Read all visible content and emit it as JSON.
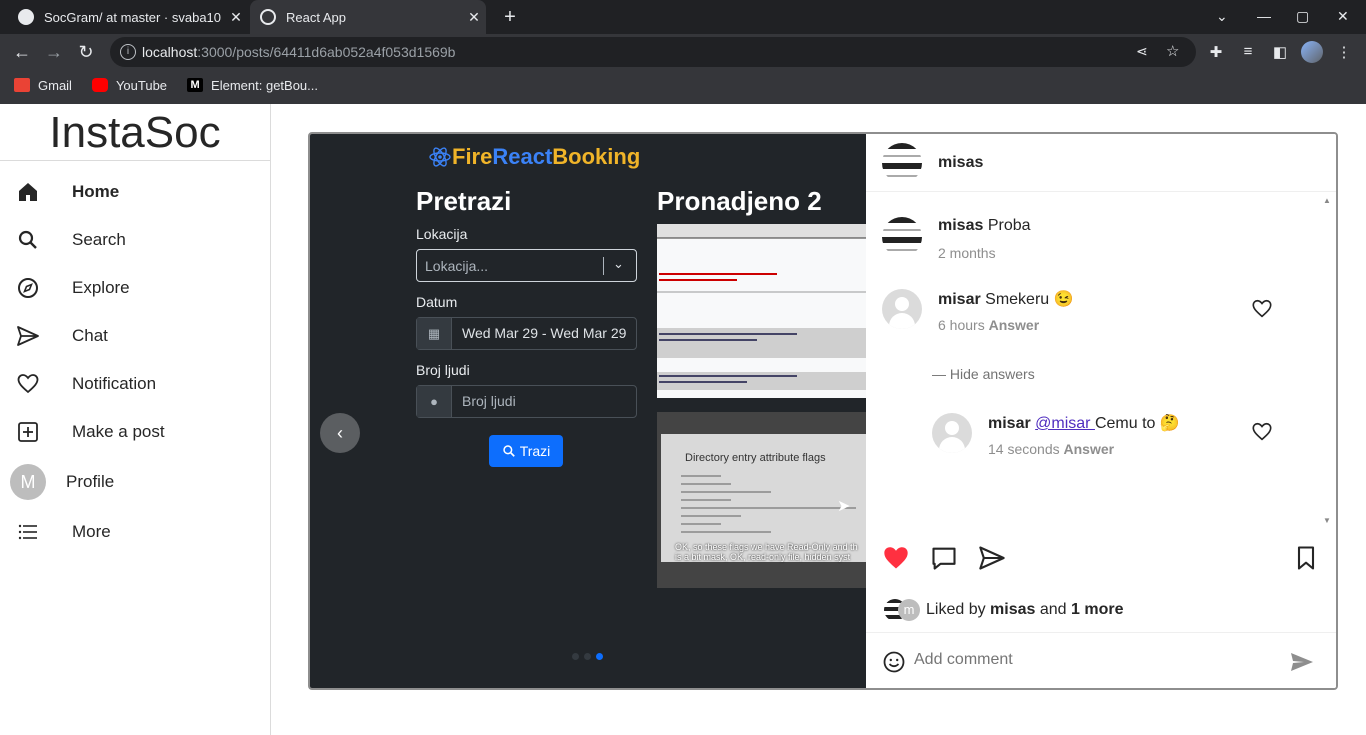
{
  "browser": {
    "tabs": [
      {
        "title": "SocGram/ at master · svaba10"
      },
      {
        "title": "React App"
      }
    ],
    "url_host": "localhost",
    "url_rest": ":3000/posts/64411d6ab052a4f053d1569b",
    "bookmarks": [
      {
        "label": "Gmail",
        "icon": "gmail-icon",
        "color": "#ea4335"
      },
      {
        "label": "YouTube",
        "icon": "youtube-icon",
        "color": "#ff0000"
      },
      {
        "label": "Element: getBou...",
        "icon": "mdn-icon",
        "color": "#000000"
      }
    ]
  },
  "sidebar": {
    "logo": "InstaSoc",
    "items": [
      {
        "label": "Home",
        "icon": "home-icon"
      },
      {
        "label": "Search",
        "icon": "search-icon"
      },
      {
        "label": "Explore",
        "icon": "compass-icon"
      },
      {
        "label": "Chat",
        "icon": "send-icon"
      },
      {
        "label": "Notification",
        "icon": "heart-icon"
      },
      {
        "label": "Make a post",
        "icon": "plus-square-icon"
      },
      {
        "label": "Profile",
        "icon": "avatar",
        "avatar_letter": "M"
      },
      {
        "label": "More",
        "icon": "menu-icon"
      }
    ]
  },
  "media": {
    "brand": {
      "part1": "Fire",
      "part2": "React",
      "part3": "Booking"
    },
    "search_heading": "Pretrazi",
    "found_heading": "Pronadjeno 2",
    "location_label": "Lokacija",
    "location_placeholder": "Lokacija...",
    "date_label": "Datum",
    "date_value": "Wed Mar 29 - Wed Mar 29",
    "people_label": "Broj ljudi",
    "people_placeholder": "Broj ljudi",
    "search_button": "Trazi",
    "thumb2_title": "Directory entry attribute flags",
    "thumb2_caption1": "OK, so these flags we have Read-Only and th",
    "thumb2_caption2": "is a bit mask, OK, read-only file, hidden syst",
    "active_slide": 3,
    "slide_count": 3
  },
  "post": {
    "author": "misas",
    "caption_user": "misas",
    "caption_text": "Proba",
    "caption_time": "2 months",
    "comments": [
      {
        "user": "misar",
        "text": "Smekeru 😉",
        "time": "6 hours",
        "answer_label": "Answer"
      }
    ],
    "hide_answers": "— Hide answers",
    "replies": [
      {
        "user": "misar",
        "mention": "@misar ",
        "text": "Cemu to 🤔",
        "time": "14 seconds",
        "answer_label": "Answer"
      }
    ],
    "liked_prefix": "Liked by ",
    "liked_user": "misas",
    "liked_mid": " and ",
    "liked_more": "1 more",
    "liked_avatar_letter": "m",
    "comment_placeholder": "Add comment",
    "liked": true,
    "like_color": "#ff3040"
  }
}
